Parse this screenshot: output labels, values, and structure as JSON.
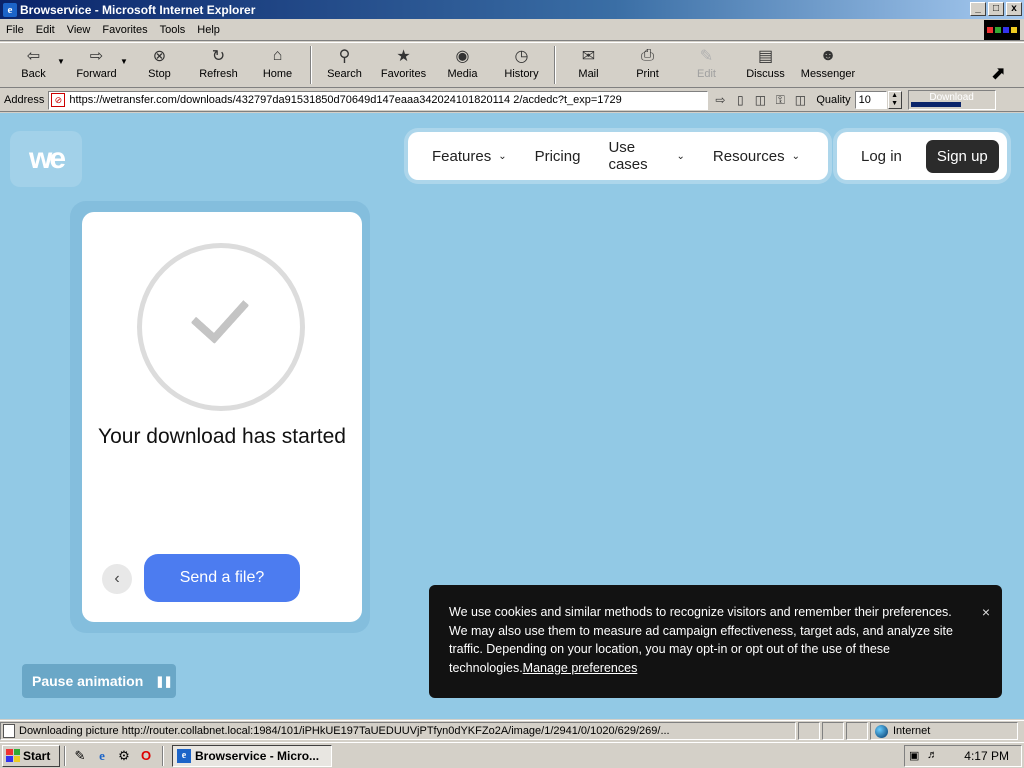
{
  "window": {
    "title": "Browservice - Microsoft Internet Explorer",
    "buttons": [
      "_",
      "□",
      "x"
    ]
  },
  "menu": {
    "items": [
      "File",
      "Edit",
      "View",
      "Favorites",
      "Tools",
      "Help"
    ]
  },
  "toolbar": {
    "back": "Back",
    "forward": "Forward",
    "stop": "Stop",
    "refresh": "Refresh",
    "home": "Home",
    "search": "Search",
    "favorites": "Favorites",
    "media": "Media",
    "history": "History",
    "mail": "Mail",
    "print": "Print",
    "edit": "Edit",
    "discuss": "Discuss",
    "messenger": "Messenger"
  },
  "address": {
    "label": "Address",
    "url": "https://wetransfer.com/downloads/432797da91531850d70649d147eaaa342024101820114 2/acdedc?t_exp=1729",
    "quality_label": "Quality",
    "quality_value": "10",
    "progress_text": "Download",
    "progress_fraction": 0.6
  },
  "site": {
    "logo": "we",
    "nav": {
      "features": "Features",
      "pricing": "Pricing",
      "use_cases": "Use cases",
      "resources": "Resources"
    },
    "login": "Log in",
    "signup": "Sign up",
    "card": {
      "title": "Your download has started",
      "send_button": "Send a file?"
    },
    "pause_button": "Pause animation",
    "cookie": {
      "text": "We use cookies and similar methods to recognize visitors and remember their preferences. We may also use them to measure ad campaign effectiveness, target ads, and analyze site traffic. Depending on your location, you may opt-in or opt out of the use of these technologies.",
      "link": "Manage preferences",
      "close": "×"
    }
  },
  "status": {
    "text": "Downloading picture http://router.collabnet.local:1984/101/iPHkUE197TaUEDUUVjPTfyn0dYKFZo2A/image/1/2941/0/1020/629/269/...",
    "zone": "Internet"
  },
  "taskbar": {
    "start": "Start",
    "task": "Browservice - Micro...",
    "clock": "4:17 PM"
  },
  "colors": {
    "page_bg": "#92c9e5",
    "send_button": "#4c7cf0",
    "signup_bg": "#2b2b2b",
    "cookie_bg": "#121212"
  }
}
